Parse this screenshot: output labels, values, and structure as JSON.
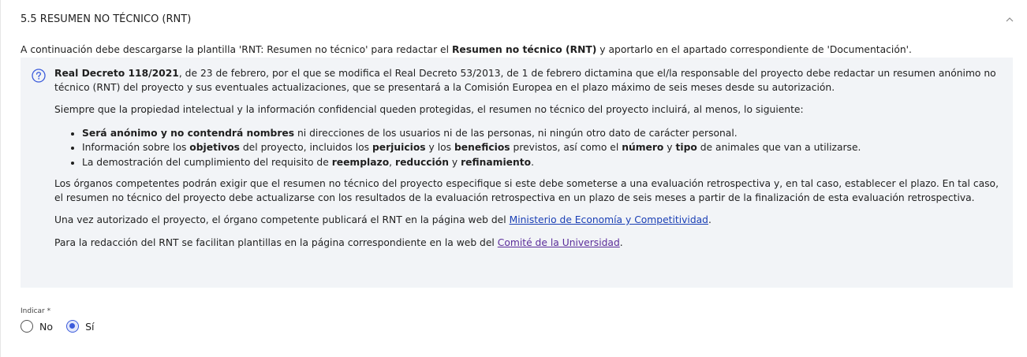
{
  "section": {
    "title": "5.5 RESUMEN NO TÉCNICO (RNT)",
    "collapse_icon": "chevron-up-icon"
  },
  "intro": {
    "part1": "A continuación debe descargarse la plantilla 'RNT: Resumen no técnico' para redactar el ",
    "bold": "Resumen no técnico (RNT)",
    "part2": " y aportarlo en el apartado correspondiente de 'Documentación'."
  },
  "info": {
    "icon": "help-circle-icon",
    "p1_bold": "Real Decreto 118/2021",
    "p1_text": ", de 23 de febrero, por el que se modifica el Real Decreto 53/2013, de 1 de febrero dictamina que el/la responsable del proyecto debe redactar un resumen anónimo no técnico (RNT) del proyecto y sus eventuales actualizaciones, que se presentará a la Comisión Europea en el plazo máximo de seis meses desde su autorización.",
    "p2": "Siempre que la propiedad intelectual y la información confidencial queden protegidas, el resumen no técnico del proyecto incluirá, al menos, lo siguiente:",
    "bullets": {
      "b1_bold": "Será anónimo y no contendrá nombres",
      "b1_text": " ni direcciones de los usuarios ni de las personas, ni ningún otro dato de carácter personal.",
      "b2_t1": "Información sobre los ",
      "b2_b1": "objetivos",
      "b2_t2": " del proyecto, incluidos los ",
      "b2_b2": "perjuicios",
      "b2_t3": " y los ",
      "b2_b3": "beneficios",
      "b2_t4": " previstos, así como el ",
      "b2_b4": "número",
      "b2_t5": " y ",
      "b2_b5": "tipo",
      "b2_t6": " de animales que van a utilizarse.",
      "b3_t1": "La demostración del cumplimiento del requisito de ",
      "b3_b1": "reemplazo",
      "b3_t2": ", ",
      "b3_b2": "reducción",
      "b3_t3": " y ",
      "b3_b3": "refinamiento",
      "b3_t4": "."
    },
    "p3": "Los órganos competentes podrán exigir que el resumen no técnico del proyecto especifique si este debe someterse a una evaluación retrospectiva y, en tal caso, establecer el plazo. En tal caso, el resumen no técnico del proyecto debe actualizarse con los resultados de la evaluación retrospectiva en un plazo de seis meses a partir de la finalización de esta evaluación retrospectiva.",
    "p4_text": "Una vez autorizado el proyecto, el órgano competente publicará el RNT en la página web del ",
    "p4_link": "Ministerio de Economía y Competitividad",
    "p4_end": ".",
    "p5_text": "Para la redacción del RNT se facilitan plantillas en la página correspondiente en la web del ",
    "p5_link": "Comité de la Universidad",
    "p5_end": "."
  },
  "field": {
    "label": "Indicar *",
    "options": [
      {
        "label": "No",
        "checked": false
      },
      {
        "label": "Sí",
        "checked": true
      }
    ]
  },
  "colors": {
    "accent": "#3b5bdb",
    "info_bg": "#f2f4f7",
    "link": "#1a3fb5",
    "visited_link": "#5b2d9a"
  }
}
